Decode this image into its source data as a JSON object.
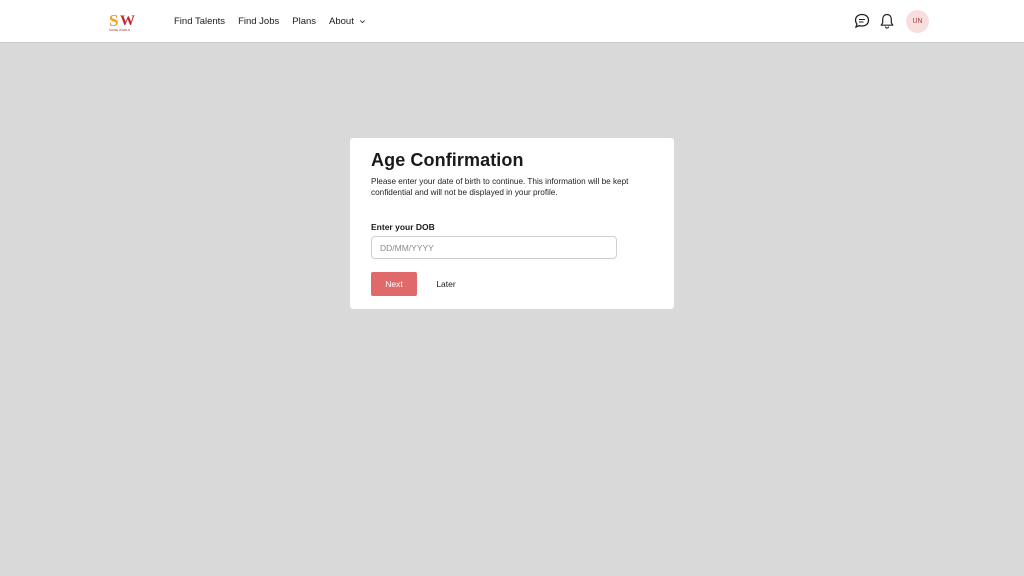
{
  "header": {
    "logo_text": "SW",
    "logo_tagline": "SHINE WORLD",
    "nav": [
      {
        "label": "Find Talents"
      },
      {
        "label": "Find Jobs"
      },
      {
        "label": "Plans"
      },
      {
        "label": "About"
      }
    ],
    "avatar_initials": "UN"
  },
  "modal": {
    "title": "Age Confirmation",
    "description_line1": "Please enter your date of birth to continue. This information will be kept",
    "description_line2": "confidential and will not be displayed in your profile.",
    "dob_label": "Enter your DOB",
    "dob_placeholder": "DD/MM/YYYY",
    "dob_value": "",
    "next_label": "Next",
    "later_label": "Later"
  },
  "colors": {
    "overlay": "#d9d9d9",
    "accent": "#e06a6a",
    "avatar_bg": "#f8dede",
    "logo_orange": "#f0a020",
    "logo_red": "#c0282d"
  },
  "icons": [
    "chat-icon",
    "bell-icon",
    "chevron-down-icon"
  ]
}
